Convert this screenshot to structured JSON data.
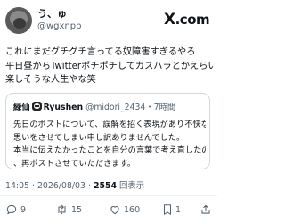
{
  "header": {
    "display_name": "う、ゅ",
    "handle": "@wgxnpp",
    "logo_text": "X",
    "logo_suffix": ".com"
  },
  "tweet": {
    "lines": [
      "これにまだグチグチ言ってる奴障害すぎるやろ",
      "平日昼からTwitterポチポチしてカスハラとかえらい",
      "楽しそうな人生やな笑"
    ]
  },
  "quote": {
    "name": "緑仙",
    "name_suffix": "Ryushen",
    "handle": "@midori_2434",
    "separator": "・",
    "time": "7時間",
    "lines": [
      "先日のポストについて、誤解を招く表現があり不快な",
      "思いをさせてしまい申し訳ありませんでした。",
      "本当に伝えたかったことを自分の言葉で考え直したので",
      "、再ポストさせていただきます。"
    ]
  },
  "meta": {
    "time": "14:05 · 2026/08/03 · ",
    "views": "2554",
    "views_label": " 回表示"
  },
  "actions": {
    "replies": "9",
    "reposts": "15",
    "likes": "160",
    "bookmarks": "1"
  },
  "colors": {
    "text": "#0f1419",
    "secondary": "#536471",
    "border": "#cfd9de"
  }
}
